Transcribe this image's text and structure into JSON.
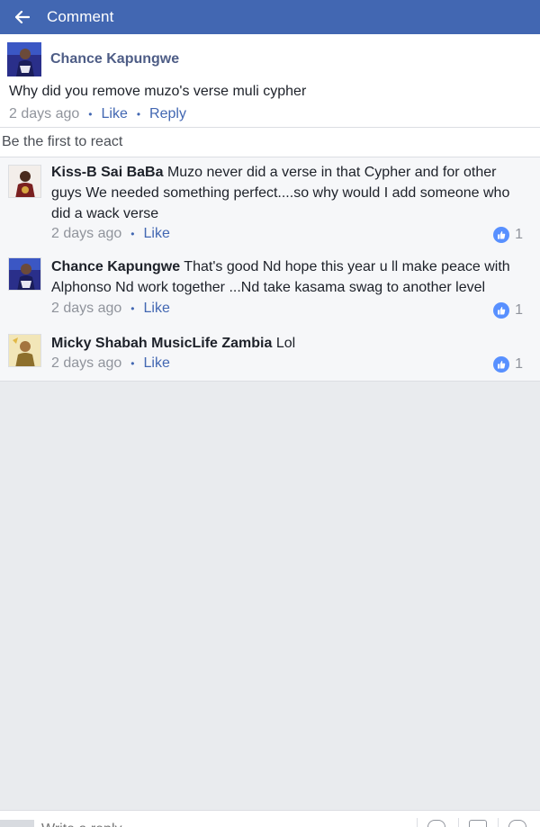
{
  "header": {
    "title": "Comment",
    "back_icon": "arrow-left-icon",
    "color": "#4267b2"
  },
  "post": {
    "author": "Chance Kapungwe",
    "text": "Why did you remove muzo's verse muli cypher",
    "time": "2 days ago",
    "like_label": "Like",
    "reply_label": "Reply"
  },
  "reactions": {
    "text": "Be the first to react"
  },
  "comments": [
    {
      "author": "Kiss-B Sai BaBa",
      "text": "Muzo never did a verse in that Cypher  and for other guys We needed something perfect....so why would I add someone who did a wack verse",
      "time": "2 days ago",
      "like_label": "Like",
      "reaction_count": "1"
    },
    {
      "author": "Chance Kapungwe",
      "text": "That's good Nd hope this year u ll make peace with Alphonso Nd work together ...Nd take kasama swag to another level",
      "time": "2 days ago",
      "like_label": "Like",
      "reaction_count": "1"
    },
    {
      "author": "Micky Shabah MusicLife Zambia",
      "text": "Lol",
      "time": "2 days ago",
      "like_label": "Like",
      "reaction_count": "1"
    }
  ],
  "composer": {
    "placeholder": "Write a reply..."
  },
  "colors": {
    "accent": "#4267b2",
    "like_bubble": "#5890ff",
    "background": "#e9ebee"
  }
}
